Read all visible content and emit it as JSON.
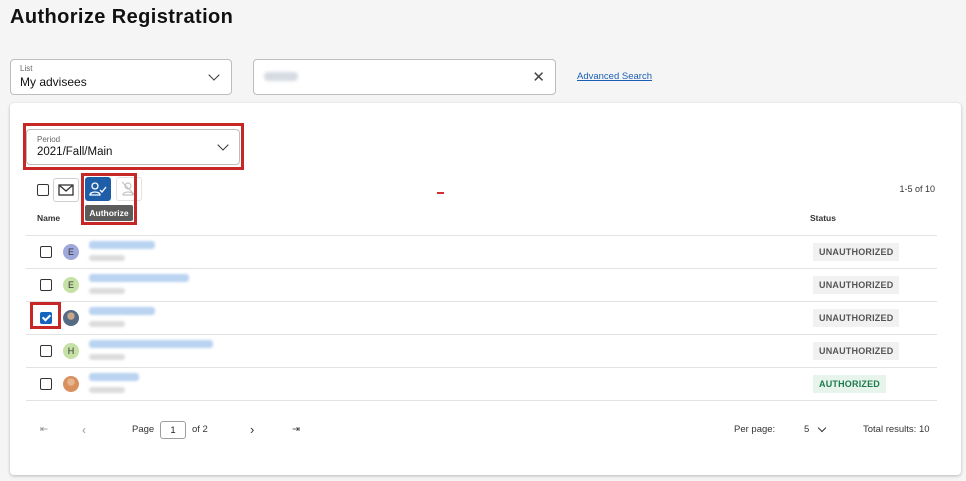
{
  "page": {
    "title": "Authorize Registration"
  },
  "list_select": {
    "label": "List",
    "value": "My advisees"
  },
  "search": {
    "value": ""
  },
  "advanced_search": {
    "label": "Advanced Search"
  },
  "period_select": {
    "label": "Period",
    "value": "2021/Fall/Main"
  },
  "toolbar": {
    "email_icon": "envelope-icon",
    "authorize_icon": "user-check-icon",
    "unauthorize_icon": "user-unauthorize-icon",
    "tooltip": "Authorize",
    "count": "1-5 of 10"
  },
  "table": {
    "columns": {
      "name": "Name",
      "status": "Status"
    },
    "rows": [
      {
        "initial": "E",
        "avatar_color": "#9fa8da",
        "photo": false,
        "checked": false,
        "status": "UNAUTHORIZED"
      },
      {
        "initial": "E",
        "avatar_color": "#c5e1a5",
        "photo": false,
        "checked": false,
        "status": "UNAUTHORIZED"
      },
      {
        "initial": "",
        "avatar_color": "#556b84",
        "photo": true,
        "checked": true,
        "status": "UNAUTHORIZED"
      },
      {
        "initial": "H",
        "avatar_color": "#c5e1a5",
        "photo": false,
        "checked": false,
        "status": "UNAUTHORIZED"
      },
      {
        "initial": "",
        "avatar_color": "#d9905e",
        "photo": true,
        "checked": false,
        "status": "AUTHORIZED"
      }
    ]
  },
  "pagination": {
    "page_label": "Page",
    "page_value": "1",
    "of_label": "of 2",
    "per_page_label": "Per page:",
    "per_page_value": "5",
    "total": "Total results: 10"
  },
  "colors": {
    "accent": "#1e5ea8",
    "highlight": "#c62828",
    "authorized": "#1e7a4c"
  }
}
